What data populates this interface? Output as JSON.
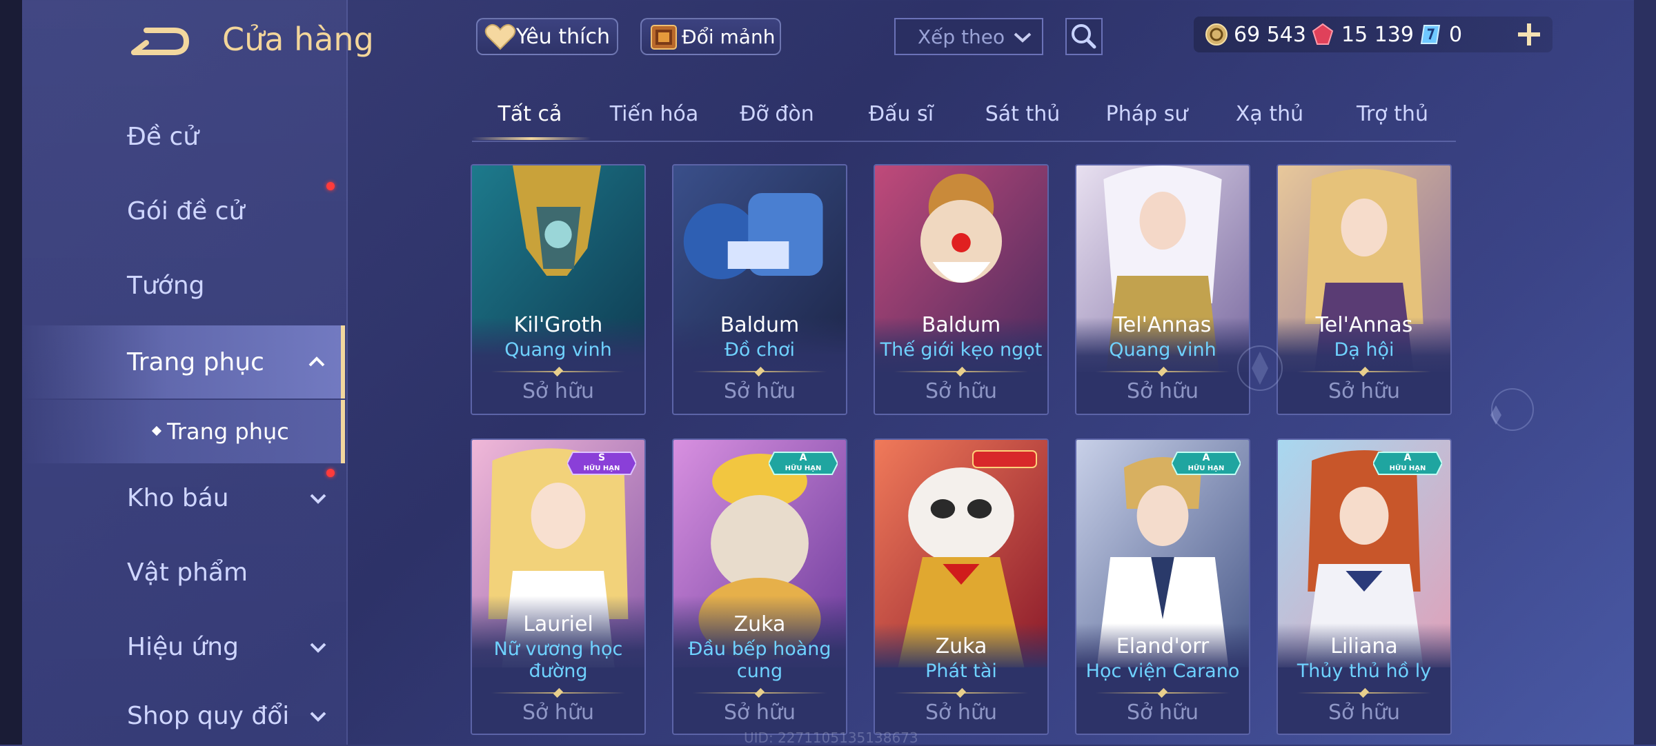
{
  "header": {
    "title": "Cửa hàng",
    "favorite_label": "Yêu thích",
    "exchange_label": "Đổi mảnh",
    "sort_label": "Xếp theo"
  },
  "currency": {
    "gold": "69 543",
    "gems": "15 139",
    "vouchers": "0"
  },
  "sidebar": {
    "items": [
      {
        "label": "Đề cử"
      },
      {
        "label": "Gói đề cử"
      },
      {
        "label": "Tướng"
      },
      {
        "label": "Trang phục"
      },
      {
        "label": "Trang phục"
      },
      {
        "label": "Kho báu"
      },
      {
        "label": "Vật phẩm"
      },
      {
        "label": "Hiệu ứng"
      },
      {
        "label": "Shop quy đổi"
      }
    ]
  },
  "tabs": [
    "Tất cả",
    "Tiến hóa",
    "Đỡ đòn",
    "Đấu sĩ",
    "Sát thủ",
    "Pháp sư",
    "Xạ thủ",
    "Trợ thủ"
  ],
  "cards": [
    {
      "hero": "Kil'Groth",
      "skin": "Quang vinh",
      "status": "Sở hữu"
    },
    {
      "hero": "Baldum",
      "skin": "Đồ chơi",
      "status": "Sở hữu"
    },
    {
      "hero": "Baldum",
      "skin": "Thế giới kẹo ngọt",
      "status": "Sở hữu"
    },
    {
      "hero": "Tel'Annas",
      "skin": "Quang vinh",
      "status": "Sở hữu"
    },
    {
      "hero": "Tel'Annas",
      "skin": "Dạ hội",
      "status": "Sở hữu"
    },
    {
      "hero": "Lauriel",
      "skin": "Nữ vương học đường",
      "skin_line1": "Nữ vương học",
      "skin_line2": "đường",
      "status": "Sở hữu",
      "badge_grade": "S",
      "badge_text": "HỮU HẠN"
    },
    {
      "hero": "Zuka",
      "skin": "Đầu bếp hoàng cung",
      "skin_line1": "Đầu bếp hoàng",
      "skin_line2": "cung",
      "status": "Sở hữu",
      "badge_grade": "A",
      "badge_text": "HỮU HẠN"
    },
    {
      "hero": "Zuka",
      "skin": "Phát tài",
      "status": "Sở hữu"
    },
    {
      "hero": "Eland'orr",
      "skin": "Học viện Carano",
      "status": "Sở hữu",
      "badge_grade": "A",
      "badge_text": "HỮU HẠN"
    },
    {
      "hero": "Liliana",
      "skin": "Thủy thủ hồ ly",
      "status": "Sở hữu",
      "badge_grade": "A",
      "badge_text": "HỮU HẠN"
    }
  ],
  "uid": "UID: 2271105135138673",
  "colors": {
    "accent_gold": "#f2d79e",
    "skin_name": "#6fd2ff",
    "badge_s": "#8a3fd8",
    "badge_a": "#1fa5a0",
    "notify_dot": "#ff3b3b"
  },
  "icons": {
    "back": "back-arrow-icon",
    "favorite": "heart-icon",
    "exchange": "fragment-chest-icon",
    "search": "search-icon",
    "gold": "gold-coin-icon",
    "gems": "red-gem-icon",
    "voucher": "voucher-icon",
    "plus": "plus-icon"
  }
}
